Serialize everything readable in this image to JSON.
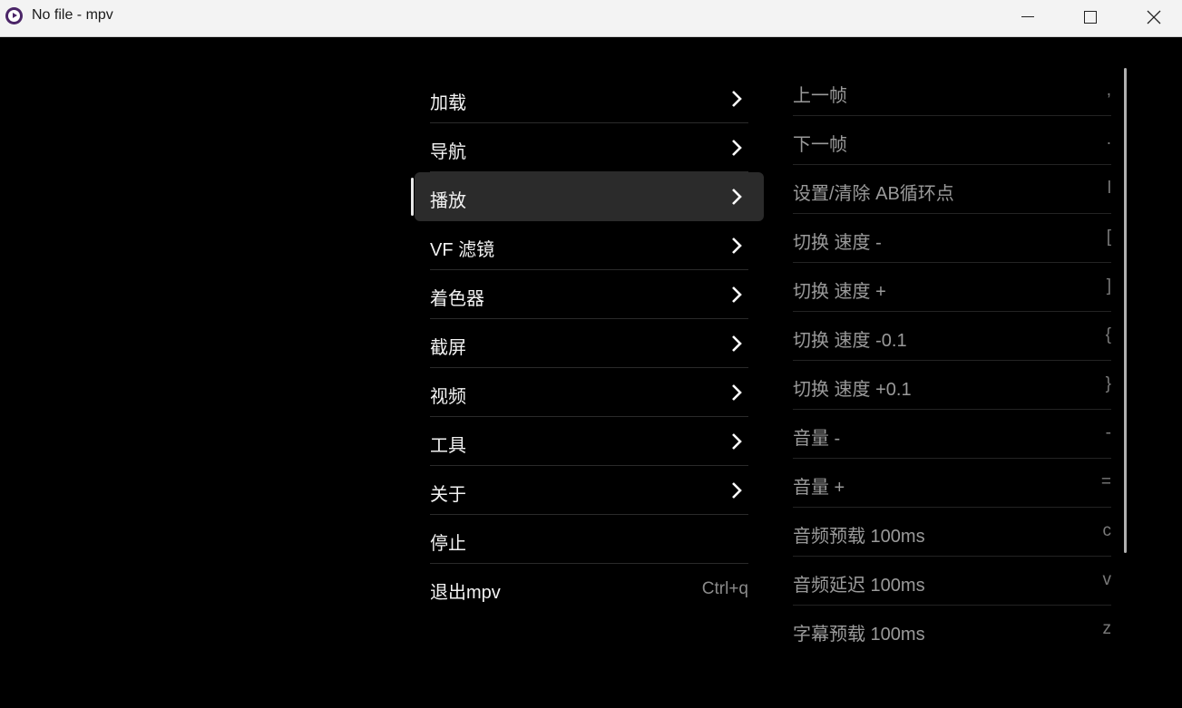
{
  "window": {
    "title": "No file - mpv",
    "icon": "mpv-app-icon"
  },
  "menu": {
    "items": [
      {
        "label": "加载",
        "submenu": true
      },
      {
        "label": "导航",
        "submenu": true
      },
      {
        "label": "播放",
        "submenu": true,
        "active": true
      },
      {
        "label": "VF 滤镜",
        "submenu": true
      },
      {
        "label": "着色器",
        "submenu": true
      },
      {
        "label": "截屏",
        "submenu": true
      },
      {
        "label": "视频",
        "submenu": true
      },
      {
        "label": "工具",
        "submenu": true
      },
      {
        "label": "关于",
        "submenu": true
      },
      {
        "label": "停止",
        "submenu": false
      },
      {
        "label": "退出mpv",
        "submenu": false,
        "shortcut": "Ctrl+q"
      }
    ]
  },
  "submenu": {
    "items": [
      {
        "label": "上一帧",
        "key": ","
      },
      {
        "label": "下一帧",
        "key": "."
      },
      {
        "label": "设置/清除 AB循环点",
        "key": "l"
      },
      {
        "label": "切换 速度 -",
        "key": "["
      },
      {
        "label": "切换 速度 +",
        "key": "]"
      },
      {
        "label": "切换 速度 -0.1",
        "key": "{"
      },
      {
        "label": "切换 速度 +0.1",
        "key": "}"
      },
      {
        "label": "音量 -",
        "key": "-"
      },
      {
        "label": "音量 +",
        "key": "="
      },
      {
        "label": "音频预载 100ms",
        "key": "c"
      },
      {
        "label": "音频延迟 100ms",
        "key": "v"
      },
      {
        "label": "字幕预载 100ms",
        "key": "z"
      }
    ]
  },
  "colors": {
    "background": "#000000",
    "active_item": "#2b2b2b",
    "titlebar": "#f3f3f3"
  }
}
